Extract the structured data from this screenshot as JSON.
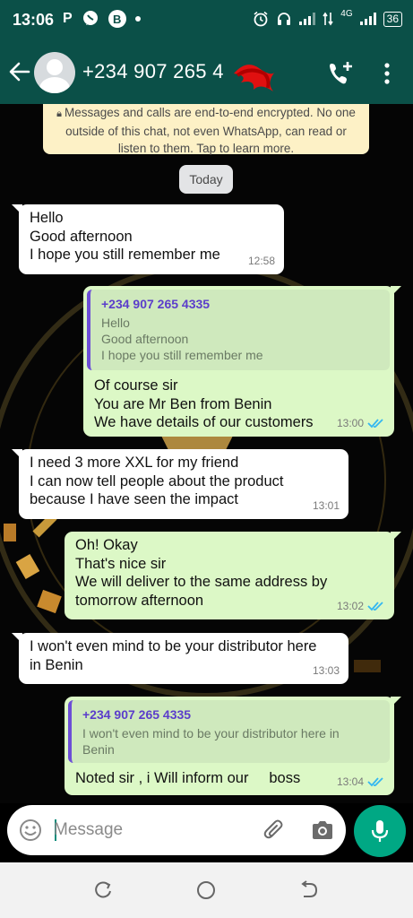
{
  "status_bar": {
    "time": "13:06",
    "left_glyphs": [
      "P",
      "B"
    ],
    "network_type": "4G",
    "battery": "36"
  },
  "header": {
    "contact_name": "+234 907 265 4"
  },
  "chat": {
    "encryption_notice": "Messages and calls are end-to-end encrypted. No one outside of this chat, not even WhatsApp, can read or listen to them. Tap to learn more.",
    "date_chip": "Today",
    "messages": [
      {
        "direction": "incoming",
        "lines": [
          "Hello",
          "Good afternoon",
          "I hope you still remember me"
        ],
        "time": "12:58"
      },
      {
        "direction": "outgoing",
        "quote": {
          "author": "+234 907 265 4335",
          "lines": [
            "Hello",
            "Good afternoon",
            "I hope you still remember me"
          ]
        },
        "lines": [
          "Of course sir",
          "You are Mr Ben from Benin",
          "We have details of our customers"
        ],
        "time": "13:00"
      },
      {
        "direction": "incoming",
        "lines": [
          "I need 3 more XXL for my friend",
          "I can now tell people about the product",
          "because I have seen the impact"
        ],
        "time": "13:01"
      },
      {
        "direction": "outgoing",
        "lines": [
          "Oh! Okay",
          "That's nice sir",
          "We will deliver to the same address by",
          "tomorrow afternoon"
        ],
        "time": "13:02"
      },
      {
        "direction": "incoming",
        "lines": [
          "I won't even mind to be your distributor here",
          "in Benin"
        ],
        "time": "13:03"
      },
      {
        "direction": "outgoing",
        "quote": {
          "author": "+234 907 265 4335",
          "lines": [
            "I won't even mind to be your distributor here in",
            "Benin"
          ]
        },
        "lines": [
          "Noted sir , i Will inform our     boss"
        ],
        "time": "13:04"
      }
    ]
  },
  "composer": {
    "placeholder": "Message"
  },
  "colors": {
    "header": "#0b5048",
    "outgoing_bubble": "#dcf8c6",
    "incoming_bubble": "#ffffff",
    "accent": "#00a884",
    "read_ticks": "#34b7f1"
  },
  "icons": {
    "back": "arrow-left-icon",
    "call": "add-call-icon",
    "menu": "more-vert-icon",
    "emoji": "emoji-icon",
    "attach": "paperclip-icon",
    "camera": "camera-icon",
    "mic": "mic-icon"
  }
}
